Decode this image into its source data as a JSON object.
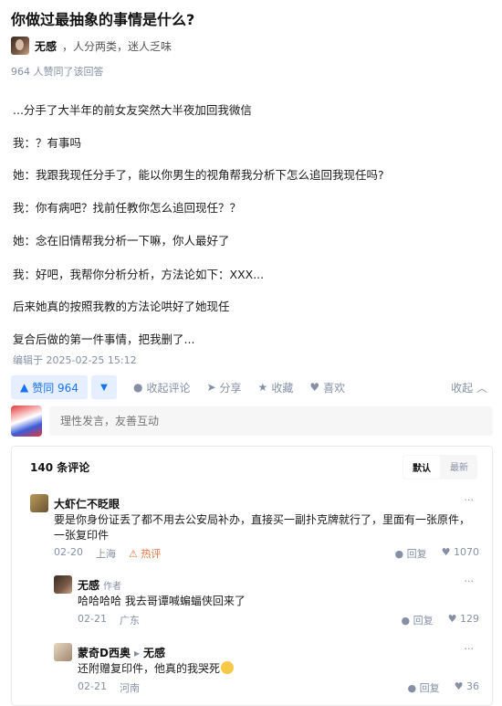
{
  "question": {
    "title": "你做过最抽象的事情是什么?"
  },
  "author": {
    "name": "无感",
    "bio": "人分两类，迷人乏味"
  },
  "voters_text": "964 人赞同了该回答",
  "content": [
    "...分手了大半年的前女友突然大半夜加回我微信",
    "我：？有事吗",
    "她：我跟我现任分手了，能以你男生的视角帮我分析下怎么追回我现任吗?",
    "我：你有病吧？找前任教你怎么追回现任？？",
    "她：念在旧情帮我分析一下嘛，你人最好了",
    "我：好吧，我帮你分析分析，方法论如下：XXX...",
    "后来她真的按照我教的方法论哄好了她现任",
    "复合后做的第一件事情，把我删了..."
  ],
  "edited": "编辑于 2025-02-25 15:12",
  "actions": {
    "vote_up": "赞同 964",
    "collapse_comments": "收起评论",
    "share": "分享",
    "favorite": "收藏",
    "like": "喜欢",
    "collapse": "收起"
  },
  "comment_input": {
    "placeholder": "理性发言，友善互动"
  },
  "comments_header": {
    "count": "140 条评论",
    "sort_default": "默认",
    "sort_latest": "最新"
  },
  "comments": [
    {
      "name": "大虾仁不眨眼",
      "text_line1": "要是你身份证丢了都不用去公安局补办，直接买一副扑克牌就行了，里面有一张原件，",
      "text_line2": "一张复印件",
      "date": "02-20",
      "location": "上海",
      "badge": "热评",
      "reply": "回复",
      "likes": "1070"
    },
    {
      "name": "无感",
      "tag": "作者",
      "text": "哈哈哈哈 我去哥谭喊蝙蝠侠回来了",
      "date": "02-21",
      "location": "广东",
      "reply": "回复",
      "likes": "129"
    },
    {
      "name": "蒙奇D西奥",
      "reply_to": "无感",
      "text": "还附赠复印件，他真的我哭死",
      "date": "02-21",
      "location": "河南",
      "reply": "回复",
      "likes": "36"
    }
  ]
}
